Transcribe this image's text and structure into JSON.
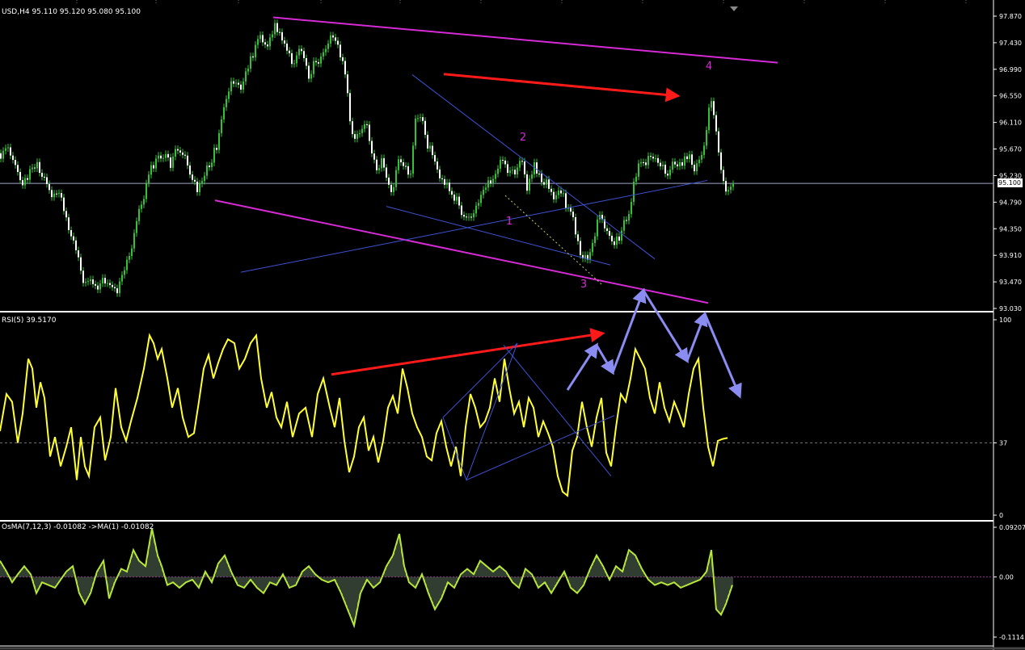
{
  "colors": {
    "background": "#000000",
    "grid": "#6e6e6e",
    "bull": "#33c233",
    "bear": "#ffffff",
    "current_price_line": "#a0a6c8",
    "rsi_line": "#ffff33",
    "osma_hist": "#5f7a5f",
    "osma_signal": "#b6e63a",
    "channel": "#d62ad6",
    "trend_blue": "#3f52d4",
    "arrow_red": "#ff1a1a",
    "arrow_periwinkle": "#8a8cf2",
    "separator": "#ffffff",
    "price_tag_bg": "#ffffff",
    "price_tag_text": "#000000"
  },
  "price_panel": {
    "header": "USD,H4  95.110 95.120 95.080 95.100",
    "current_price": "95.100",
    "axis_ticks": [
      "97.870",
      "97.430",
      "96.990",
      "96.550",
      "96.110",
      "95.670",
      "95.230",
      "94.790",
      "94.350",
      "93.910",
      "93.470",
      "93.030"
    ],
    "wave_labels": [
      "1",
      "2",
      "3",
      "4"
    ]
  },
  "rsi_panel": {
    "header": "RSI(5) 39.5170",
    "axis_ticks": [
      "100",
      "37",
      "0"
    ]
  },
  "osma_panel": {
    "header": "OsMA(7,12,3) -0.01082  ->MA(1) -0.01082",
    "axis_ticks": [
      "0.09207",
      "0.00",
      "-0.1114"
    ]
  },
  "chart_data": [
    {
      "type": "candlestick",
      "title": "USD,H4",
      "ylim": [
        93.03,
        97.87
      ],
      "current": 95.1,
      "close_path_x": [
        0,
        10,
        20,
        30,
        38,
        45,
        55,
        65,
        72,
        80,
        90,
        98,
        105,
        112,
        118,
        125,
        132,
        140,
        147,
        155,
        162,
        170,
        178,
        185,
        192,
        200,
        210,
        220,
        228,
        236,
        244,
        252,
        260,
        267,
        273,
        280,
        288,
        296,
        304,
        312,
        320,
        330,
        338,
        345,
        352,
        360,
        370,
        380,
        390,
        398,
        405,
        412,
        418,
        425,
        432,
        438,
        445,
        452,
        460,
        466,
        472,
        478,
        485,
        492,
        500,
        507,
        513,
        520,
        527,
        535,
        542,
        550,
        557,
        565,
        572,
        580,
        588,
        596,
        604,
        612,
        620,
        628,
        636,
        644,
        652,
        660,
        668,
        676,
        684,
        692,
        700,
        707,
        714,
        720,
        725,
        730,
        735,
        740,
        745,
        752,
        760,
        766,
        772,
        778,
        784,
        790,
        796,
        802,
        810,
        818,
        826,
        834,
        842,
        850,
        858,
        866,
        872,
        878,
        882,
        886,
        890,
        896,
        902,
        906
      ],
      "close_path_y": [
        95.6,
        95.7,
        95.3,
        95.1,
        95.3,
        95.4,
        95.2,
        94.9,
        95.0,
        94.6,
        94.1,
        93.7,
        93.4,
        93.5,
        93.3,
        93.6,
        93.4,
        93.3,
        93.4,
        93.7,
        94.1,
        94.6,
        94.9,
        95.3,
        95.5,
        95.6,
        95.4,
        95.7,
        95.5,
        95.2,
        95.0,
        95.2,
        95.5,
        95.7,
        96.2,
        96.6,
        96.8,
        96.7,
        97.0,
        97.2,
        97.5,
        97.3,
        97.7,
        97.6,
        97.4,
        97.1,
        97.3,
        96.9,
        97.1,
        97.2,
        97.4,
        97.6,
        97.3,
        97.0,
        96.2,
        95.8,
        95.9,
        96.1,
        95.6,
        95.3,
        95.5,
        95.1,
        94.9,
        95.5,
        95.4,
        95.2,
        96.1,
        96.3,
        95.8,
        95.5,
        95.3,
        95.1,
        94.9,
        94.8,
        94.6,
        94.5,
        94.7,
        94.9,
        95.1,
        95.2,
        95.6,
        95.3,
        95.2,
        95.5,
        95.0,
        95.4,
        95.2,
        95.1,
        94.9,
        95.0,
        94.7,
        94.5,
        94.2,
        93.8,
        93.9,
        94.0,
        94.3,
        94.6,
        94.4,
        94.3,
        94.1,
        94.2,
        94.5,
        94.7,
        95.2,
        95.5,
        95.4,
        95.6,
        95.5,
        95.4,
        95.3,
        95.5,
        95.4,
        95.6,
        95.3,
        95.6,
        95.9,
        96.6,
        96.3,
        95.9,
        95.4,
        94.9,
        95.1,
        95.1
      ]
    },
    {
      "type": "line",
      "title": "RSI(5)",
      "ylim": [
        0,
        100
      ],
      "level": 37,
      "current": 39.517,
      "x": [
        0,
        8,
        15,
        22,
        28,
        35,
        40,
        45,
        50,
        55,
        62,
        68,
        75,
        82,
        88,
        95,
        100,
        105,
        110,
        117,
        124,
        130,
        137,
        143,
        150,
        156,
        162,
        170,
        178,
        185,
        190,
        195,
        200,
        207,
        213,
        220,
        226,
        233,
        240,
        246,
        252,
        258,
        264,
        270,
        276,
        282,
        290,
        296,
        303,
        310,
        317,
        323,
        330,
        336,
        342,
        348,
        355,
        362,
        370,
        378,
        386,
        393,
        400,
        408,
        414,
        420,
        426,
        432,
        438,
        444,
        450,
        456,
        462,
        468,
        474,
        480,
        486,
        492,
        498,
        504,
        510,
        516,
        522,
        528,
        534,
        540,
        546,
        552,
        558,
        564,
        570,
        576,
        582,
        588,
        594,
        600,
        606,
        612,
        618,
        624,
        630,
        636,
        642,
        648,
        654,
        660,
        666,
        672,
        678,
        684,
        690,
        696,
        702,
        708,
        714,
        720,
        726,
        732,
        738,
        744,
        750,
        756,
        762,
        768,
        774,
        780,
        786,
        792,
        798,
        804,
        810,
        816,
        822,
        828,
        834,
        840,
        846,
        852,
        858,
        864,
        870,
        876,
        882,
        888,
        894,
        900,
        906
      ],
      "y": [
        43,
        62,
        58,
        37,
        52,
        80,
        75,
        55,
        68,
        60,
        30,
        40,
        25,
        35,
        45,
        18,
        40,
        25,
        20,
        45,
        50,
        28,
        40,
        65,
        45,
        38,
        48,
        60,
        75,
        92,
        88,
        80,
        85,
        70,
        55,
        65,
        50,
        40,
        42,
        58,
        75,
        82,
        70,
        78,
        85,
        90,
        88,
        75,
        80,
        88,
        92,
        70,
        55,
        63,
        50,
        45,
        58,
        40,
        52,
        55,
        40,
        62,
        70,
        55,
        45,
        60,
        38,
        22,
        30,
        45,
        50,
        33,
        40,
        27,
        38,
        55,
        61,
        52,
        75,
        65,
        52,
        45,
        40,
        30,
        28,
        42,
        48,
        35,
        25,
        35,
        20,
        45,
        62,
        55,
        45,
        48,
        55,
        70,
        58,
        80,
        65,
        52,
        58,
        45,
        60,
        55,
        40,
        48,
        42,
        35,
        20,
        12,
        10,
        33,
        40,
        58,
        45,
        35,
        50,
        60,
        32,
        25,
        45,
        62,
        58,
        70,
        85,
        80,
        75,
        60,
        52,
        68,
        55,
        48,
        58,
        52,
        45,
        62,
        75,
        80,
        55,
        35,
        25,
        38,
        39,
        39.5
      ]
    },
    {
      "type": "bar",
      "title": "OsMA(7,12,3)",
      "ylim": [
        -0.1114,
        0.09207
      ],
      "current": -0.01082,
      "x": [
        0,
        8,
        15,
        22,
        30,
        38,
        45,
        52,
        60,
        68,
        75,
        82,
        90,
        98,
        105,
        112,
        120,
        128,
        135,
        142,
        150,
        157,
        165,
        172,
        180,
        188,
        195,
        200,
        207,
        214,
        222,
        230,
        238,
        246,
        254,
        262,
        270,
        278,
        286,
        294,
        302,
        310,
        318,
        326,
        334,
        342,
        350,
        358,
        366,
        374,
        382,
        390,
        398,
        406,
        414,
        422,
        430,
        438,
        446,
        454,
        462,
        470,
        478,
        486,
        494,
        500,
        506,
        514,
        522,
        530,
        538,
        546,
        554,
        562,
        570,
        578,
        586,
        594,
        602,
        610,
        618,
        626,
        634,
        642,
        650,
        658,
        666,
        674,
        682,
        690,
        698,
        706,
        714,
        722,
        730,
        738,
        746,
        754,
        762,
        770,
        778,
        786,
        794,
        802,
        810,
        818,
        826,
        834,
        842,
        850,
        858,
        866,
        874,
        880,
        886,
        892,
        898,
        906
      ],
      "y": [
        0.03,
        0.01,
        -0.01,
        0.005,
        0.02,
        0.005,
        -0.03,
        -0.01,
        -0.015,
        -0.02,
        -0.005,
        0.01,
        0.02,
        -0.03,
        -0.05,
        -0.03,
        0.01,
        0.03,
        -0.04,
        -0.01,
        0.015,
        0.01,
        0.05,
        0.03,
        0.02,
        0.09,
        0.04,
        0.02,
        -0.015,
        -0.01,
        -0.02,
        -0.01,
        -0.005,
        -0.02,
        0.01,
        -0.01,
        0.025,
        0.04,
        0.01,
        -0.015,
        -0.02,
        -0.005,
        -0.02,
        -0.03,
        -0.01,
        -0.015,
        0.005,
        -0.02,
        -0.015,
        0.01,
        0.02,
        0.005,
        -0.005,
        -0.01,
        -0.005,
        -0.03,
        -0.06,
        -0.09,
        -0.03,
        -0.005,
        -0.02,
        -0.01,
        0.02,
        0.04,
        0.08,
        0.02,
        -0.01,
        -0.02,
        0.005,
        -0.03,
        -0.06,
        -0.04,
        -0.01,
        -0.02,
        0.005,
        0.015,
        0.005,
        0.03,
        0.02,
        0.01,
        0.02,
        0.01,
        -0.01,
        -0.02,
        0.015,
        0.005,
        -0.02,
        -0.01,
        -0.03,
        -0.01,
        0.01,
        -0.02,
        -0.03,
        -0.015,
        0.015,
        0.04,
        0.02,
        -0.005,
        0.02,
        0.01,
        0.05,
        0.04,
        0.015,
        -0.005,
        -0.015,
        -0.01,
        -0.015,
        -0.01,
        -0.02,
        -0.015,
        -0.01,
        -0.005,
        0.01,
        0.05,
        -0.06,
        -0.07,
        -0.05,
        -0.015
      ]
    }
  ]
}
